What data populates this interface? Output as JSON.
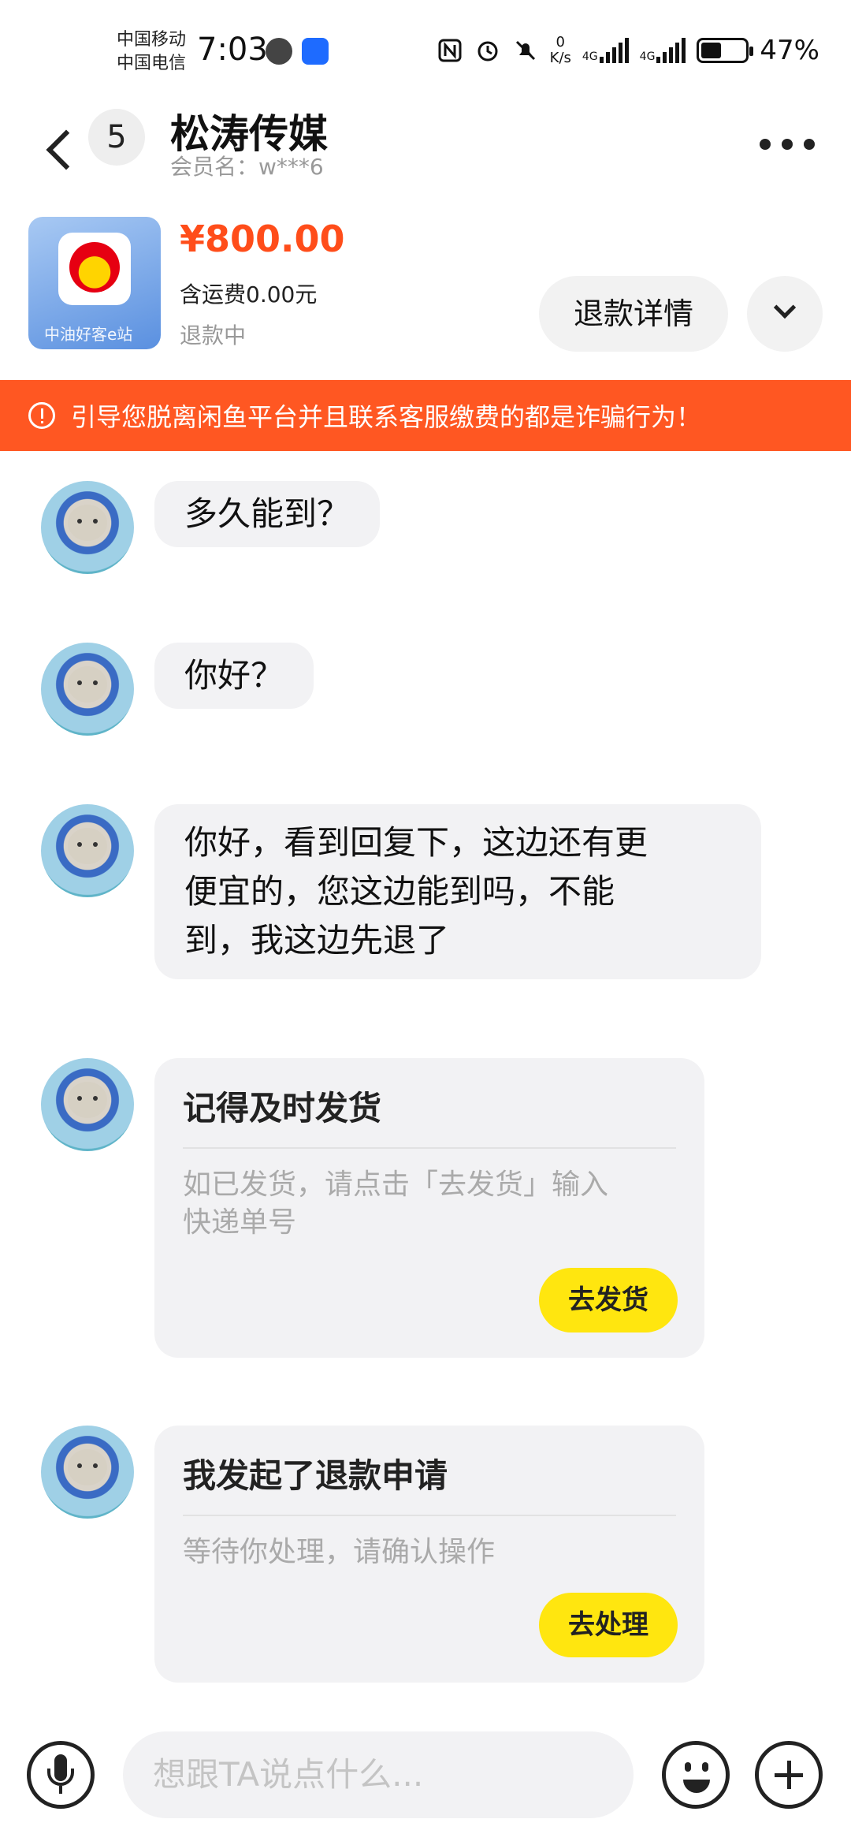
{
  "status_bar": {
    "carrier_1": "中国移动",
    "carrier_2": "中国电信",
    "time": "7:03",
    "net_speed_value": "0",
    "net_speed_unit": "K/s",
    "signal_1": "4G",
    "signal_2": "4G",
    "battery": "47%",
    "battery_level": 0.47
  },
  "header": {
    "unread_count": "5",
    "title": "松涛传媒",
    "member": "会员名：w***6"
  },
  "product": {
    "thumbnail_caption": "中油好客e站",
    "price": "¥800.00",
    "shipping": "含运费0.00元",
    "status": "退款中",
    "refund_detail_label": "退款详情"
  },
  "warning": {
    "text": "引导您脱离闲鱼平台并且联系客服缴费的都是诈骗行为！"
  },
  "messages": [
    {
      "text": "多久能到？"
    },
    {
      "text": "你好？"
    },
    {
      "lines": [
        "你好，看到回复下，这边还有更",
        "便宜的，您这边能到吗，不能",
        "到，我这边先退了"
      ]
    }
  ],
  "cards": [
    {
      "title": "记得及时发货",
      "body_lines": [
        "如已发货，请点击「去发货」输入",
        "快递单号"
      ],
      "button": "去发货"
    },
    {
      "title": "我发起了退款申请",
      "body_lines": [
        "等待你处理，请确认操作"
      ],
      "button": "去处理"
    }
  ],
  "input": {
    "placeholder": "想跟TA说点什么..."
  },
  "colors": {
    "accent_orange": "#ff4d1a",
    "warning_bg": "#ff5722",
    "button_yellow": "#ffe60f"
  }
}
